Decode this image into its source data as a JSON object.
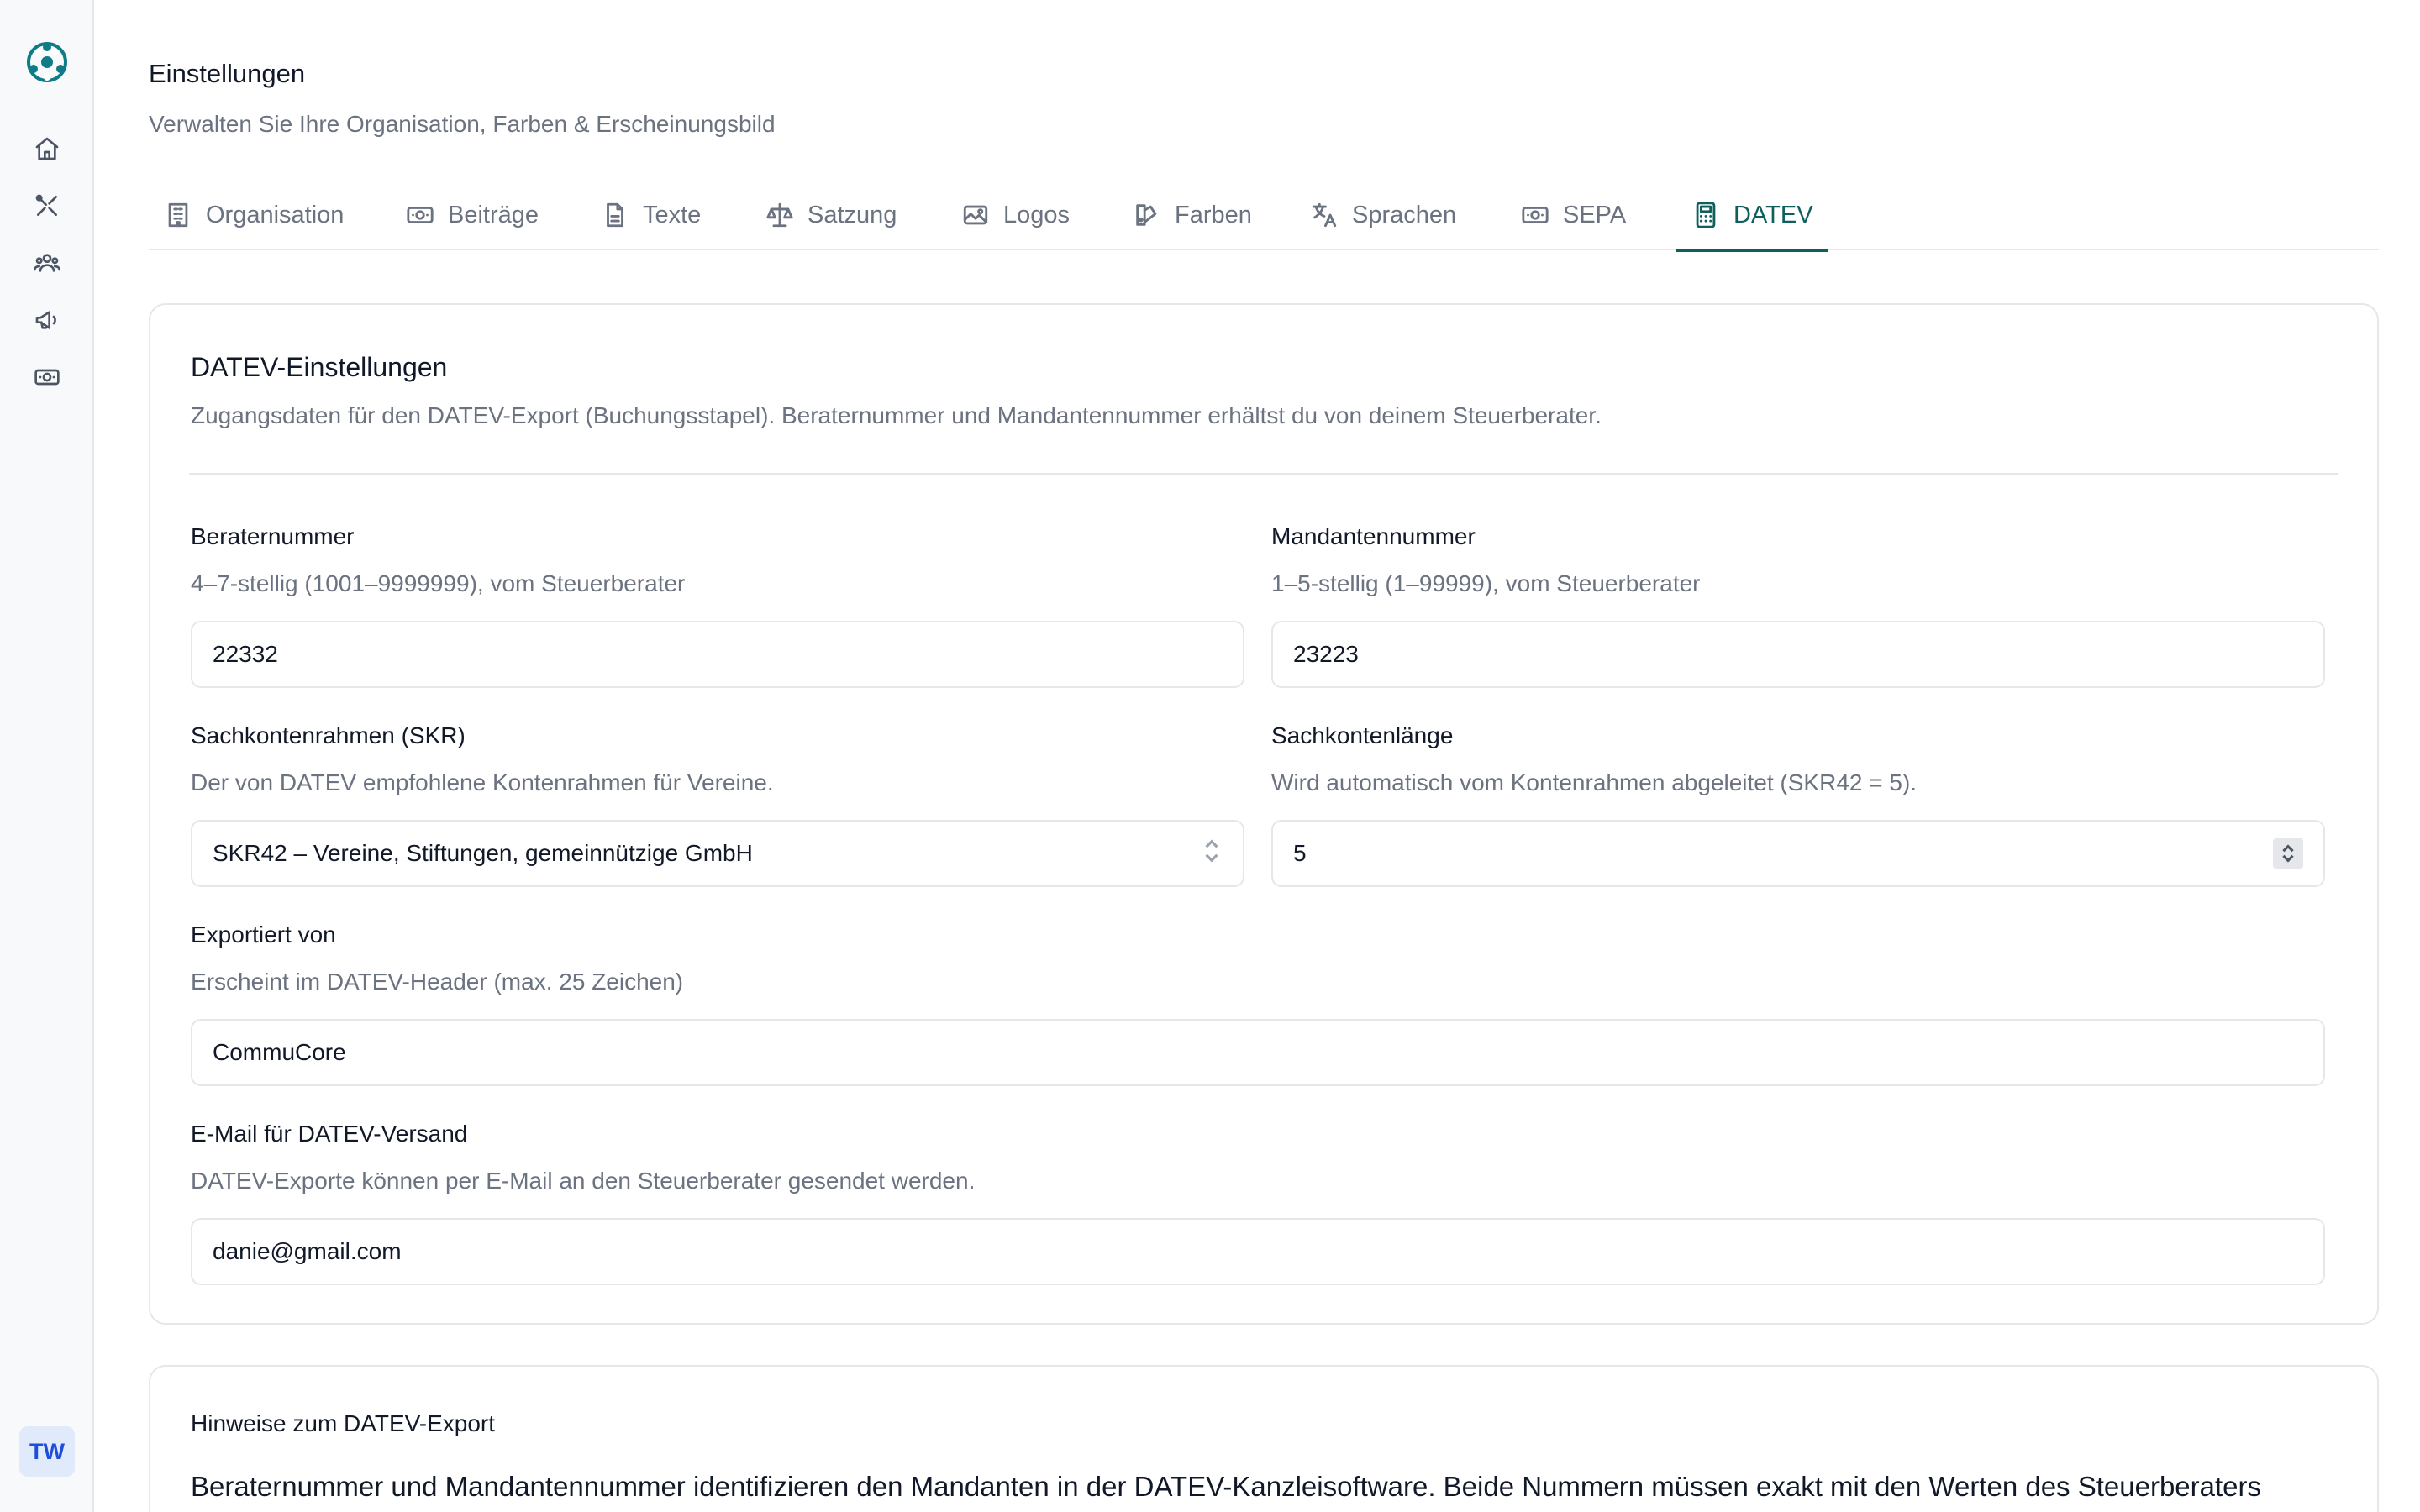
{
  "header": {
    "title": "Einstellungen",
    "subtitle": "Verwalten Sie Ihre Organisation, Farben & Erscheinungsbild"
  },
  "sidebar": {
    "items": [
      {
        "icon": "home-icon"
      },
      {
        "icon": "tools-icon"
      },
      {
        "icon": "members-icon"
      },
      {
        "icon": "megaphone-icon"
      },
      {
        "icon": "money-icon"
      }
    ],
    "avatar_initials": "TW"
  },
  "tabs": [
    {
      "label": "Organisation",
      "icon": "building-icon"
    },
    {
      "label": "Beiträge",
      "icon": "banknote-icon"
    },
    {
      "label": "Texte",
      "icon": "document-icon"
    },
    {
      "label": "Satzung",
      "icon": "scale-icon"
    },
    {
      "label": "Logos",
      "icon": "image-icon"
    },
    {
      "label": "Farben",
      "icon": "palette-icon"
    },
    {
      "label": "Sprachen",
      "icon": "translate-icon"
    },
    {
      "label": "SEPA",
      "icon": "banknote-icon"
    },
    {
      "label": "DATEV",
      "icon": "calculator-icon",
      "active": true
    }
  ],
  "datev": {
    "title": "DATEV-Einstellungen",
    "description": "Zugangsdaten für den DATEV-Export (Buchungsstapel). Beraternummer und Mandantennummer erhältst du von deinem Steuerberater.",
    "berater": {
      "label": "Beraternummer",
      "help": "4–7-stellig (1001–9999999), vom Steuerberater",
      "value": "22332"
    },
    "mandant": {
      "label": "Mandantennummer",
      "help": "1–5-stellig (1–99999), vom Steuerberater",
      "value": "23223"
    },
    "skr": {
      "label": "Sachkontenrahmen (SKR)",
      "help": "Der von DATEV empfohlene Kontenrahmen für Vereine.",
      "value": "SKR42 – Vereine, Stiftungen, gemeinnützige GmbH"
    },
    "laenge": {
      "label": "Sachkontenlänge",
      "help": "Wird automatisch vom Kontenrahmen abgeleitet (SKR42 = 5).",
      "value": "5"
    },
    "exportiert": {
      "label": "Exportiert von",
      "help": "Erscheint im DATEV-Header (max. 25 Zeichen)",
      "value": "CommuCore"
    },
    "email": {
      "label": "E-Mail für DATEV-Versand",
      "help": "DATEV-Exporte können per E-Mail an den Steuerberater gesendet werden.",
      "value": "danie@gmail.com"
    }
  },
  "hints": {
    "title": "Hinweise zum DATEV-Export",
    "text": "Beraternummer und Mandantennummer identifizieren den Mandanten in der DATEV-Kanzleisoftware. Beide Nummern müssen exakt mit den Werten des Steuerberaters"
  },
  "colors": {
    "accent": "#0f5f5c",
    "logo": "#0e7c86"
  }
}
